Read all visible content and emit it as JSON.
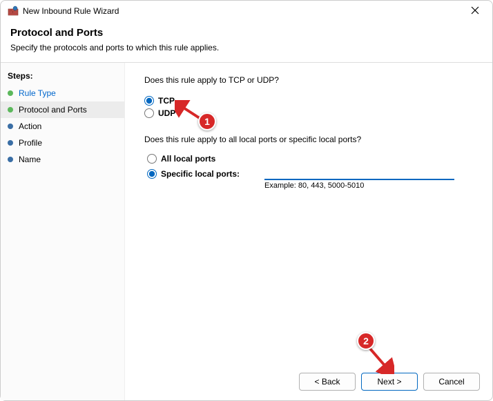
{
  "window": {
    "title": "New Inbound Rule Wizard"
  },
  "header": {
    "title": "Protocol and Ports",
    "subtitle": "Specify the protocols and ports to which this rule applies."
  },
  "sidebar": {
    "label": "Steps:",
    "items": [
      {
        "label": "Rule Type",
        "state": "done",
        "link": true
      },
      {
        "label": "Protocol and Ports",
        "state": "done",
        "current": true
      },
      {
        "label": "Action",
        "state": "pending"
      },
      {
        "label": "Profile",
        "state": "pending"
      },
      {
        "label": "Name",
        "state": "pending"
      }
    ]
  },
  "main": {
    "protocol_question": "Does this rule apply to TCP or UDP?",
    "tcp_label": "TCP",
    "udp_label": "UDP",
    "ports_question": "Does this rule apply to all local ports or specific local ports?",
    "all_ports_label": "All local ports",
    "specific_ports_label": "Specific local ports:",
    "port_value": "",
    "example_label": "Example: 80, 443, 5000-5010"
  },
  "footer": {
    "back": "< Back",
    "next": "Next >",
    "cancel": "Cancel"
  },
  "annotations": {
    "badge1": "1",
    "badge2": "2"
  }
}
